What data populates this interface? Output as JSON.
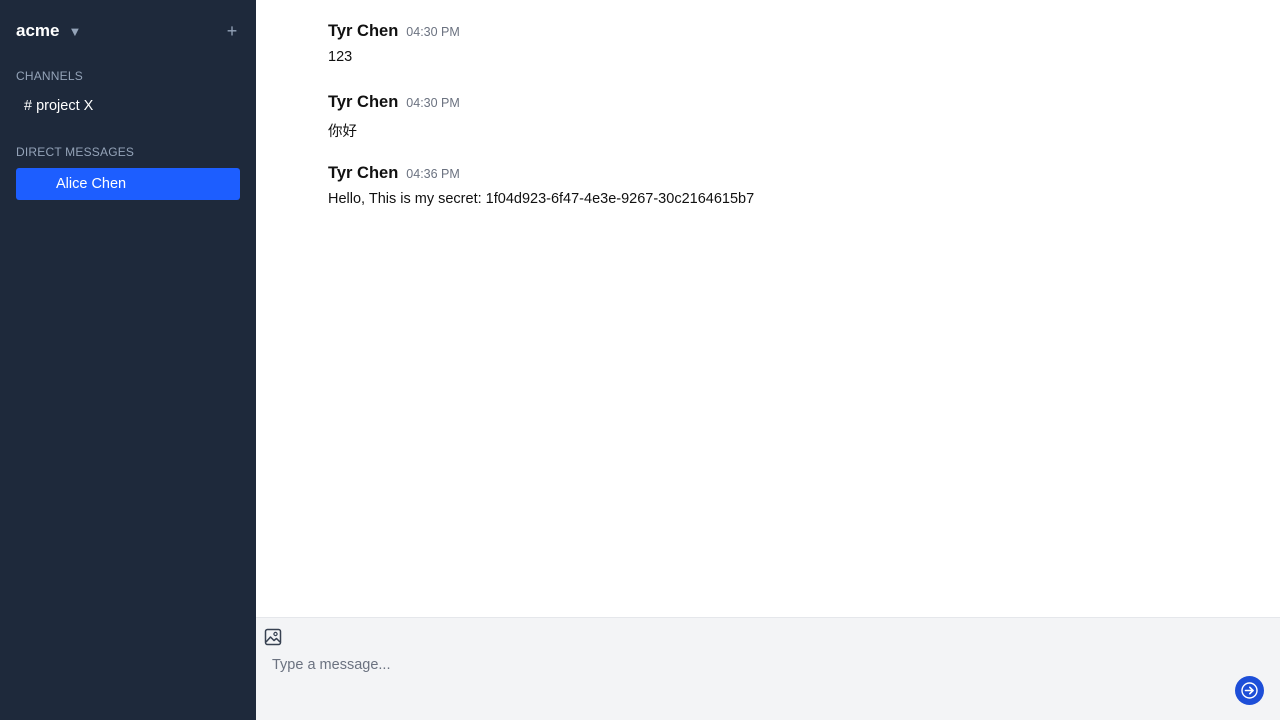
{
  "sidebar": {
    "workspace_name": "acme",
    "workspace_caret": "▼",
    "add_label": "+",
    "channels_title": "CHANNELS",
    "channels": [
      {
        "label": "# project X"
      }
    ],
    "dms_title": "DIRECT MESSAGES",
    "direct_messages": [
      {
        "label": "Alice Chen",
        "selected": true
      }
    ]
  },
  "messages": [
    {
      "author": "Tyr Chen",
      "time": "04:30 PM",
      "text": "123"
    },
    {
      "author": "Tyr Chen",
      "time": "04:30 PM",
      "text": "你好"
    },
    {
      "author": "Tyr Chen",
      "time": "04:36 PM",
      "text": "Hello, This is my secret: 1f04d923-6f47-4e3e-9267-30c2164615b7"
    }
  ],
  "composer": {
    "placeholder": "Type a message...",
    "image_icon": "image-icon",
    "send_icon": "arrow-right-icon"
  },
  "colors": {
    "sidebar_bg": "#1e293b",
    "selected_dm": "#1d5eff",
    "send_button": "#1d4ed8",
    "composer_bg": "#f3f4f6"
  }
}
